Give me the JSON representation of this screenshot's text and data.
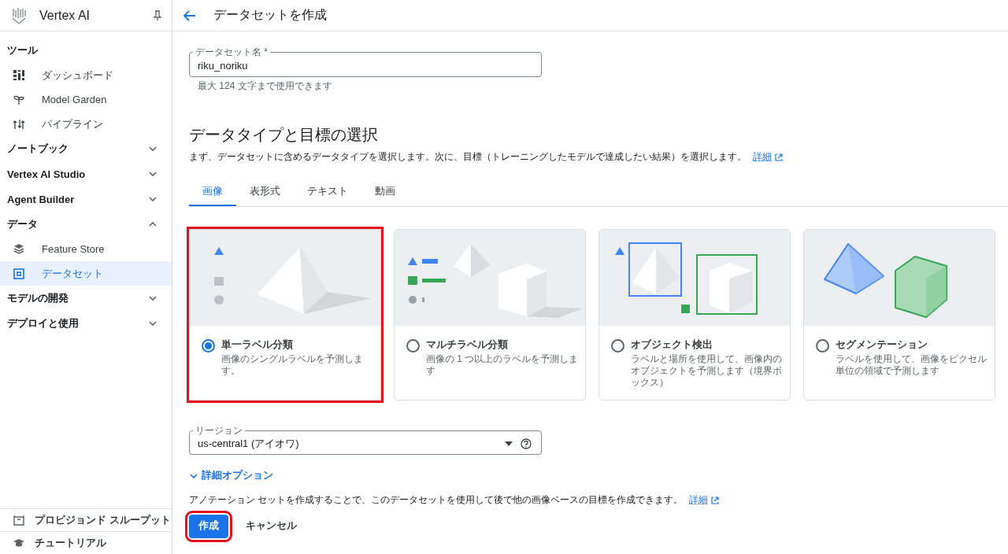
{
  "sidebar": {
    "product": "Vertex AI",
    "sections": [
      {
        "title": "ツール",
        "items": [
          {
            "label": "ダッシュボード",
            "selected": false
          },
          {
            "label": "Model Garden",
            "selected": false
          },
          {
            "label": "パイプライン",
            "selected": false
          }
        ]
      },
      {
        "title": "ノートブック",
        "expanded": false
      },
      {
        "title": "Vertex AI Studio",
        "expanded": false
      },
      {
        "title": "Agent Builder",
        "expanded": false
      },
      {
        "title": "データ",
        "expanded": true,
        "items": [
          {
            "label": "Feature Store",
            "selected": false
          },
          {
            "label": "データセット",
            "selected": true
          }
        ]
      },
      {
        "title": "モデルの開発",
        "expanded": false
      },
      {
        "title": "デプロイと使用",
        "expanded": false
      }
    ],
    "footer": [
      {
        "label": "プロビジョンド スループット"
      },
      {
        "label": "チュートリアル"
      }
    ]
  },
  "header": {
    "title": "データセットを作成"
  },
  "name_field": {
    "label": "データセット名 *",
    "value": "riku_noriku",
    "hint": "最大 124 文字まで使用できます"
  },
  "section": {
    "title": "データタイプと目標の選択",
    "description": "まず、データセットに含めるデータタイプを選択します。次に、目標（トレーニングしたモデルで達成したい結果）を選択します。",
    "link": "詳細"
  },
  "tabs": [
    {
      "label": "画像",
      "selected": true
    },
    {
      "label": "表形式",
      "selected": false
    },
    {
      "label": "テキスト",
      "selected": false
    },
    {
      "label": "動画",
      "selected": false
    }
  ],
  "objectives": [
    {
      "title": "単一ラベル分類",
      "description": "画像のシングルラベルを予測します。",
      "selected": true,
      "highlighted": true
    },
    {
      "title": "マルチラベル分類",
      "description": "画像の 1 つ以上のラベルを予測します",
      "selected": false,
      "highlighted": false
    },
    {
      "title": "オブジェクト検出",
      "description": "ラベルと場所を使用して、画像内のオブジェクトを予測します（境界ボックス）",
      "selected": false,
      "highlighted": false
    },
    {
      "title": "セグメンテーション",
      "description": "ラベルを使用して、画像をピクセル単位の領域で予測します",
      "selected": false,
      "highlighted": false
    }
  ],
  "region_field": {
    "label": "リージョン",
    "value": "us-central1 (アイオワ)"
  },
  "advanced_options": {
    "label": "詳細オプション",
    "expanded": false
  },
  "annotation_note": {
    "text": "アノテーション セットを作成することで、このデータセットを使用して後で他の画像ベースの目標を作成できます。",
    "link": "詳細"
  },
  "buttons": [
    {
      "label": "作成",
      "kind": "primary",
      "highlighted": true
    },
    {
      "label": "キャンセル",
      "kind": "text",
      "highlighted": false
    }
  ]
}
